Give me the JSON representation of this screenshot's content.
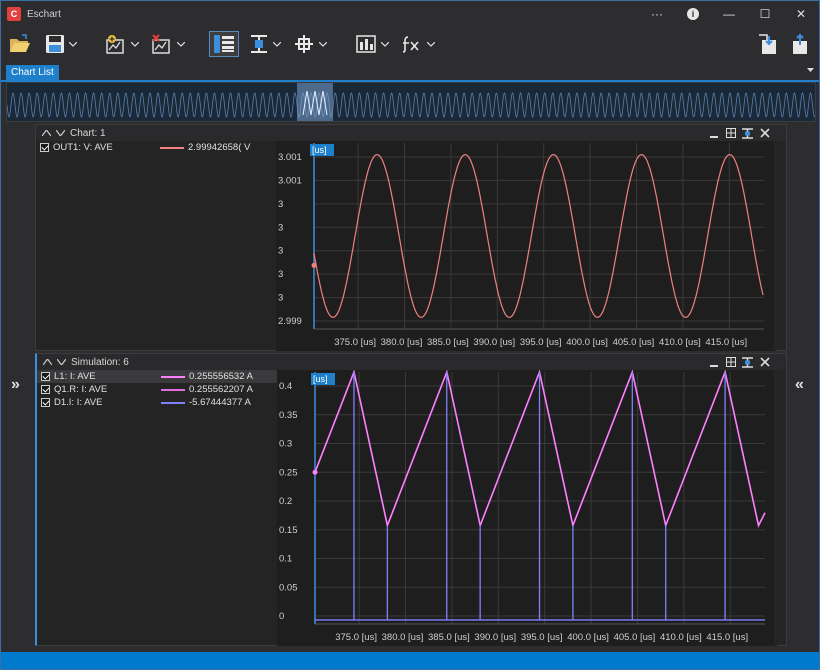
{
  "app": {
    "title": "Eschart"
  },
  "window": {
    "more_label": "···",
    "info_label": "i",
    "minimize_label": "—",
    "maximize_label": "☐",
    "close_label": "✕"
  },
  "tabs": {
    "chart_list_label": "Chart List"
  },
  "panels": [
    {
      "title": "Chart: 1",
      "cursor_label": "[us]",
      "legend": [
        {
          "checked": true,
          "name": "OUT1: V: AVE",
          "value": "2.99942658( V",
          "color": "#f08080"
        }
      ],
      "chart_data": {
        "type": "line",
        "x_ticks": [
          "375.0 [us]",
          "380.0 [us]",
          "385.0 [us]",
          "390.0 [us]",
          "395.0 [us]",
          "400.0 [us]",
          "405.0 [us]",
          "410.0 [us]",
          "415.0 [us]"
        ],
        "y_ticks": [
          "3.001",
          "3.001",
          "3",
          "3",
          "3",
          "3",
          "3",
          "2.999"
        ],
        "x_range": [
          371.0,
          419.5
        ],
        "ylim": [
          2.99925,
          3.00085
        ],
        "series": [
          {
            "name": "OUT1: V: AVE",
            "color": "#f08080",
            "shape": "sine",
            "period": 9.5,
            "phase_peak_at": 377.8,
            "min": 2.99935,
            "max": 3.00075
          }
        ]
      }
    },
    {
      "title": "Simulation: 6",
      "cursor_label": "[us]",
      "legend": [
        {
          "checked": true,
          "name": "L1: I: AVE",
          "value": "0.255556532 A",
          "color": "#ff80ff"
        },
        {
          "checked": true,
          "name": "Q1.R: I: AVE",
          "value": "0.255562207 A",
          "color": "#e070e0"
        },
        {
          "checked": true,
          "name": "D1.I: I: AVE",
          "value": "-5.67444377 A",
          "color": "#8080ff"
        }
      ],
      "chart_data": {
        "type": "line",
        "x_ticks": [
          "375.0 [us]",
          "380.0 [us]",
          "385.0 [us]",
          "390.0 [us]",
          "395.0 [us]",
          "400.0 [us]",
          "405.0 [us]",
          "410.0 [us]",
          "415.0 [us]"
        ],
        "y_ticks": [
          "0.4",
          "0.35",
          "0.3",
          "0.25",
          "0.2",
          "0.15",
          "0.1",
          "0.05",
          "0"
        ],
        "x_range": [
          371.0,
          419.5
        ],
        "ylim": [
          -0.007,
          0.428
        ],
        "series": [
          {
            "name": "L1: I: AVE",
            "color": "#ff80ff",
            "shape": "triangle",
            "peaks": [
              375.2,
              385.2,
              395.2,
              405.2,
              415.2
            ],
            "troughs": [
              378.8,
              388.8,
              398.8,
              408.8,
              418.8
            ],
            "min": 0.163,
            "max": 0.428
          },
          {
            "name": "D1.I: I: AVE",
            "color": "#8080ff",
            "shape": "pulses",
            "pulses": [
              375.2,
              378.8,
              385.2,
              388.8,
              395.2,
              398.8,
              405.2,
              408.8,
              415.2
            ],
            "min": 0.0,
            "max": 0.428
          }
        ]
      }
    }
  ],
  "icons": {
    "open": "folder-open-icon",
    "save": "save-icon",
    "add_chart": "add-chart-icon",
    "remove_chart": "remove-chart-icon",
    "list_view": "list-view-icon",
    "cursor": "cursor-icon",
    "crosshair": "crosshair-icon",
    "bar_chart": "bar-chart-icon",
    "fx": "fx-icon",
    "export": "export-icon",
    "import": "import-icon"
  },
  "colors": {
    "accent": "#007acc",
    "tab": "#1e7fcb",
    "grid": "#3a3a3a",
    "axis": "#3c8fdd"
  }
}
